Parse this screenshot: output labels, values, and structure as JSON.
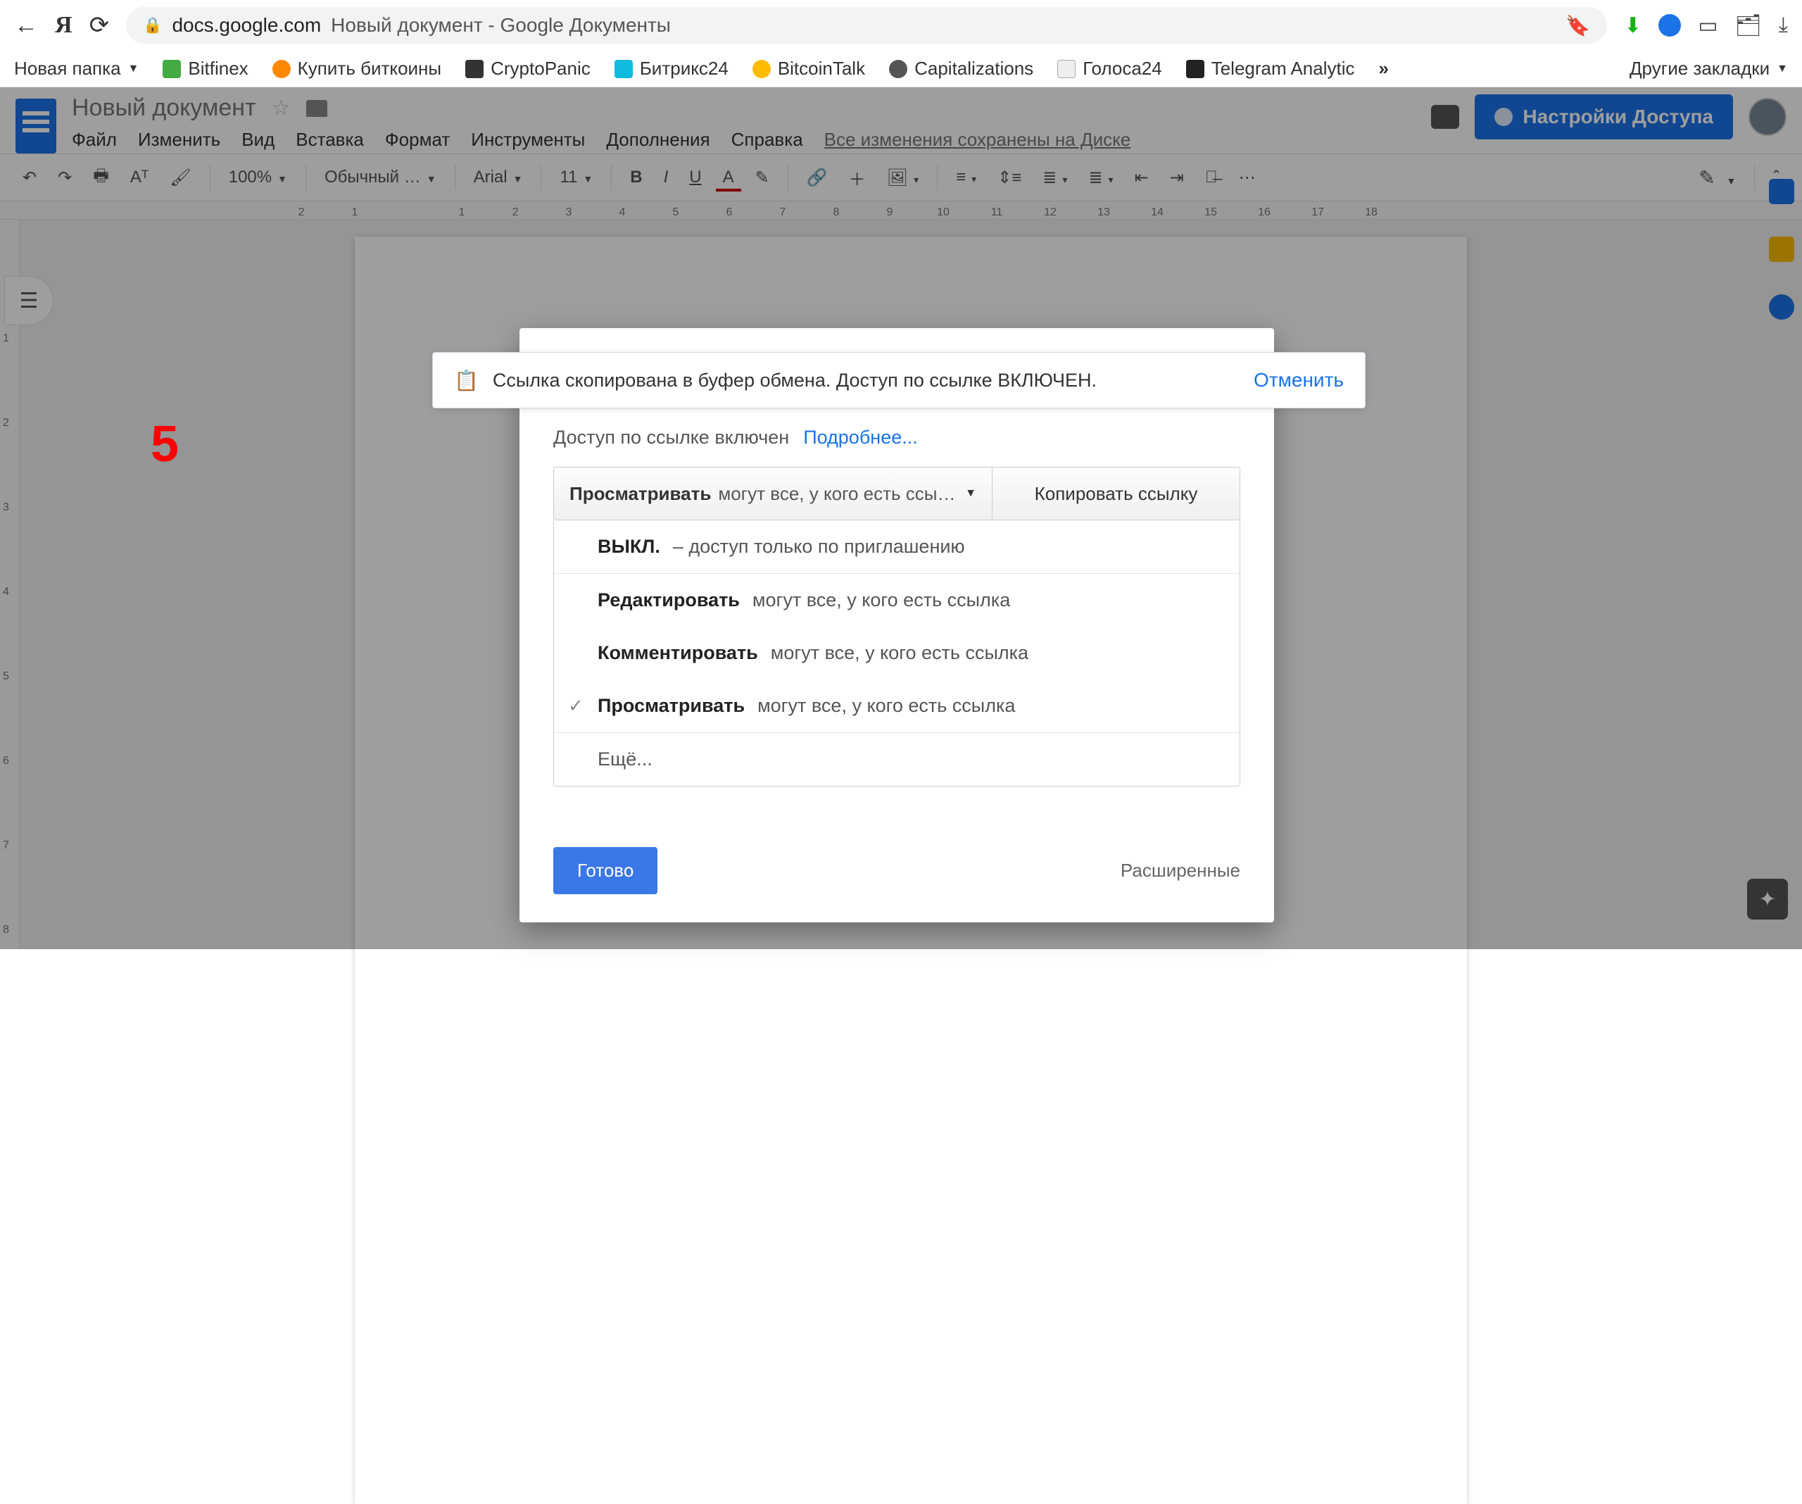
{
  "browser": {
    "domain": "docs.google.com",
    "page_title": "Новый документ - Google Документы"
  },
  "bookmarks": {
    "folder": "Новая папка",
    "items": [
      "Bitfinex",
      "Купить биткоины",
      "CryptoPanic",
      "Битрикс24",
      "BitcoinTalk",
      "Capitalizations",
      "Голоса24",
      "Telegram Analytic"
    ],
    "other": "Другие закладки"
  },
  "docs": {
    "title": "Новый документ",
    "menus": [
      "Файл",
      "Изменить",
      "Вид",
      "Вставка",
      "Формат",
      "Инструменты",
      "Дополнения",
      "Справка"
    ],
    "save_status": "Все изменения сохранены на Диске",
    "share_button": "Настройки Доступа",
    "toolbar": {
      "zoom": "100%",
      "style": "Обычный …",
      "font": "Arial",
      "size": "11"
    }
  },
  "ruler": [
    "2",
    "1",
    "",
    "1",
    "2",
    "3",
    "4",
    "5",
    "6",
    "7",
    "8",
    "9",
    "10",
    "11",
    "12",
    "13",
    "14",
    "15",
    "16",
    "17",
    "18"
  ],
  "vruler": [
    "",
    "1",
    "2",
    "3",
    "4",
    "5",
    "6",
    "7",
    "8"
  ],
  "annotation": "5",
  "toast": {
    "message": "Ссылка скопирована в буфер обмена. Доступ по ссылке ВКЛЮЧЕН.",
    "undo": "Отменить"
  },
  "dialog": {
    "heading": "Доступ по ссылке включен",
    "learn_more": "Подробнее...",
    "select_bold": "Просматривать",
    "select_rest": "могут все, у кого есть ссы…",
    "copy": "Копировать ссылку",
    "opt_off_b": "ВЫКЛ.",
    "opt_off_r": " – доступ только по приглашению",
    "opt_edit_b": "Редактировать",
    "opt_edit_r": " могут все, у кого есть ссылка",
    "opt_comment_b": "Комментировать",
    "opt_comment_r": " могут все, у кого есть ссылка",
    "opt_view_b": "Просматривать",
    "opt_view_r": " могут все, у кого есть ссылка",
    "opt_more": "Ещё...",
    "done": "Готово",
    "advanced": "Расширенные"
  }
}
